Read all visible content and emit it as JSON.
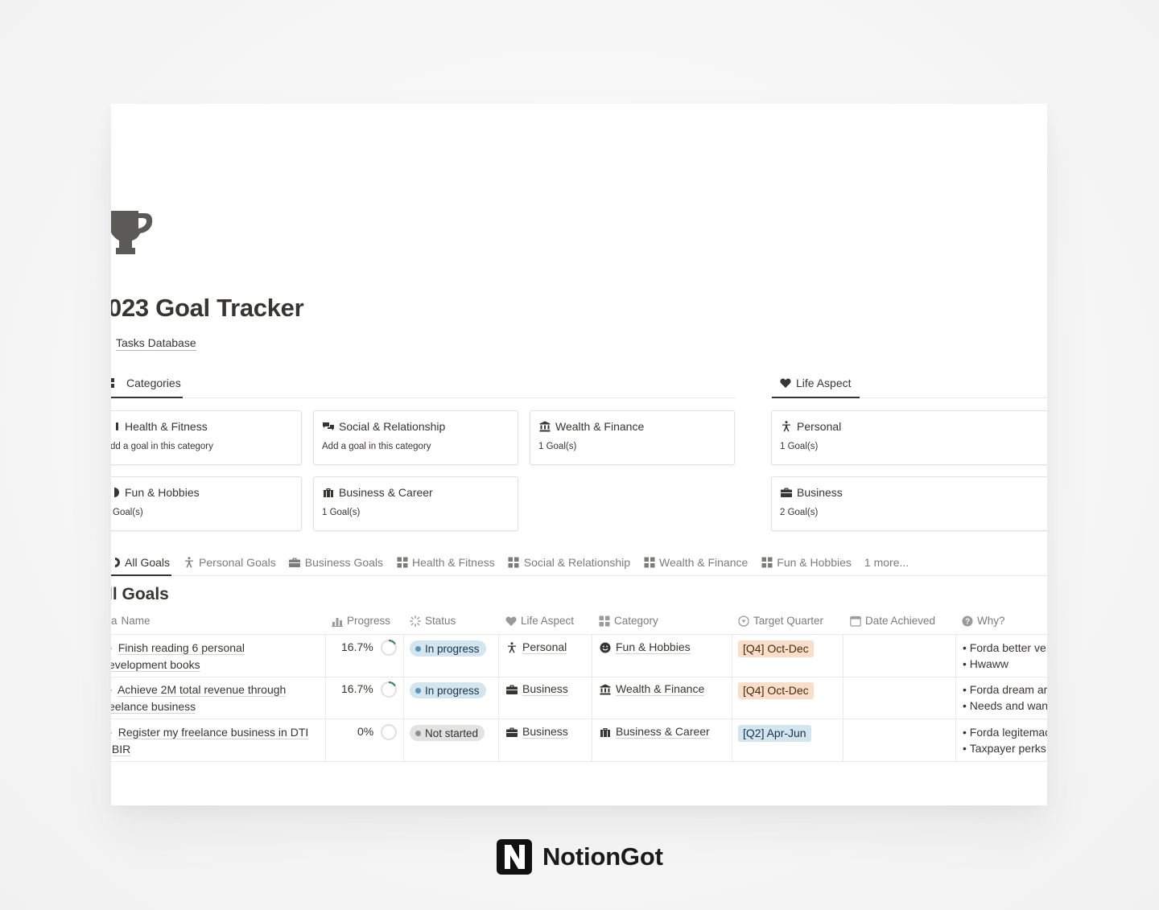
{
  "page": {
    "title": "023 Goal Tracker",
    "db_link": "Tasks Database",
    "icon": "trophy-icon"
  },
  "sections": {
    "categories": {
      "label": "Categories",
      "icon": "grid-icon"
    },
    "life_aspect": {
      "label": "Life Aspect",
      "icon": "heart-icon"
    }
  },
  "category_cards": [
    {
      "title": "Health & Fitness",
      "subtitle": "dd a goal in this category",
      "icon": "dumbbell-icon"
    },
    {
      "title": "Social & Relationship",
      "subtitle": "Add a goal in this category",
      "icon": "chat-bubbles-icon"
    },
    {
      "title": "Wealth & Finance",
      "subtitle": "1 Goal(s)",
      "icon": "bank-icon"
    },
    {
      "title": "Fun & Hobbies",
      "subtitle": "Goal(s)",
      "icon": "smiley-icon"
    },
    {
      "title": "Business & Career",
      "subtitle": "1 Goal(s)",
      "icon": "suitcase-icon"
    }
  ],
  "aspect_cards": [
    {
      "title": "Personal",
      "subtitle": "1 Goal(s)",
      "icon": "person-icon"
    },
    {
      "title": "Business",
      "subtitle": "2 Goal(s)",
      "icon": "briefcase-icon"
    }
  ],
  "views": [
    {
      "label": "All Goals",
      "icon": "target-icon",
      "active": true
    },
    {
      "label": "Personal Goals",
      "icon": "person-icon"
    },
    {
      "label": "Business Goals",
      "icon": "briefcase-icon"
    },
    {
      "label": "Health & Fitness",
      "icon": "grid-icon"
    },
    {
      "label": "Social & Relationship",
      "icon": "grid-icon"
    },
    {
      "label": "Wealth & Finance",
      "icon": "grid-icon"
    },
    {
      "label": "Fun & Hobbies",
      "icon": "grid-icon"
    },
    {
      "label": "1 more...",
      "icon": ""
    }
  ],
  "table": {
    "title": "ll Goals",
    "columns": {
      "name": "Name",
      "progress": "Progress",
      "status": "Status",
      "life_aspect": "Life Aspect",
      "category": "Category",
      "target_quarter": "Target Quarter",
      "date_achieved": "Date Achieved",
      "why": "Why?"
    },
    "rows": [
      {
        "name_line1": "Finish reading 6 personal",
        "name_line2": "evelopment books",
        "progress": "16.7%",
        "progress_value": 0.167,
        "status": "In progress",
        "life_aspect": "Personal",
        "category": "Fun & Hobbies",
        "quarter": "[Q4] Oct-Dec",
        "date_achieved": "",
        "why": [
          "Forda better ve",
          "Hwaww"
        ]
      },
      {
        "name_line1": "Achieve 2M total revenue through",
        "name_line2": "eelance business",
        "progress": "16.7%",
        "progress_value": 0.167,
        "status": "In progress",
        "life_aspect": "Business",
        "category": "Wealth & Finance",
        "quarter": "[Q4] Oct-Dec",
        "date_achieved": "",
        "why": [
          "Forda dream ar",
          "Needs and wan"
        ]
      },
      {
        "name_line1": "Register my freelance business in DTI",
        "name_line2": "BIR",
        "progress": "0%",
        "progress_value": 0,
        "status": "Not started",
        "life_aspect": "Business",
        "category": "Business & Career",
        "quarter": "[Q2] Apr-Jun",
        "date_achieved": "",
        "why": [
          "Forda legitemac",
          "Taxpayer perks"
        ]
      }
    ]
  },
  "brand": {
    "name": "NotionGot",
    "logo": "notion-n-logo"
  },
  "colors": {
    "text": "#37352f",
    "muted": "#7d7c78",
    "progress_ring": "#448361",
    "in_progress_bg": "#d3e5ef",
    "not_started_bg": "#e3e2e0",
    "q4_bg": "#fadec9",
    "q2_bg": "#d3e5ef"
  }
}
